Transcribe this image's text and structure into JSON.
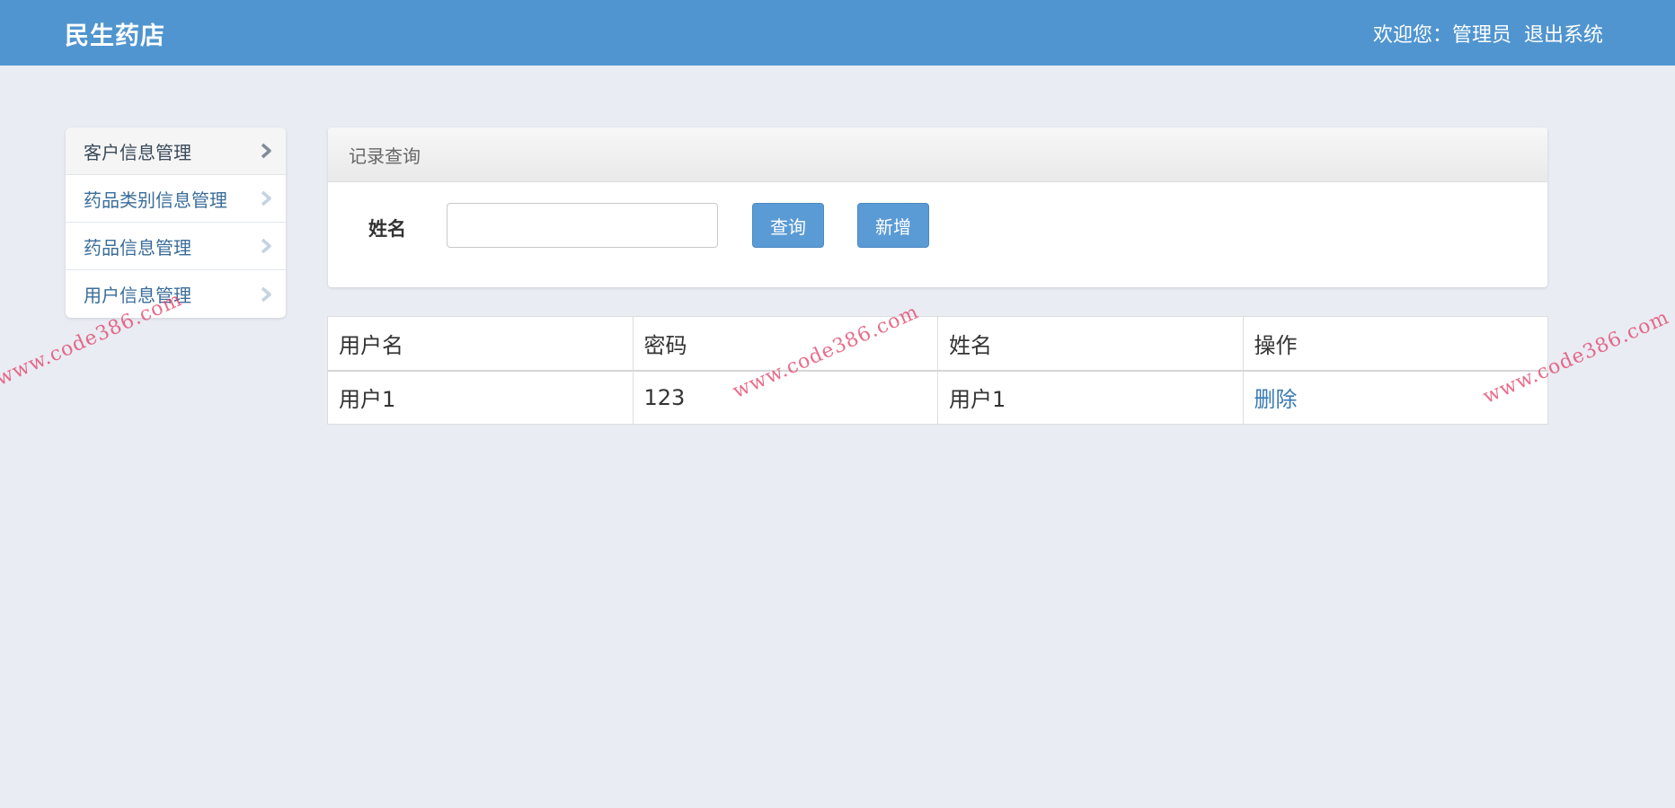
{
  "header": {
    "brand": "民生药店",
    "welcome": "欢迎您：管理员",
    "logout": "退出系统"
  },
  "sidebar": {
    "items": [
      {
        "label": "客户信息管理"
      },
      {
        "label": "药品类别信息管理"
      },
      {
        "label": "药品信息管理"
      },
      {
        "label": "用户信息管理"
      }
    ]
  },
  "panel": {
    "title": "记录查询",
    "name_label": "姓名",
    "name_value": "",
    "search_label": "查询",
    "add_label": "新增"
  },
  "table": {
    "columns": [
      "用户名",
      "密码",
      "姓名",
      "操作"
    ],
    "rows": [
      {
        "username": "用户1",
        "password": "123",
        "name": "用户1",
        "action": "删除"
      }
    ]
  },
  "watermark": "www.code386.com",
  "colors": {
    "header_bg": "#5095d0",
    "page_bg": "#e9ecf3",
    "button_bg": "#5b9bd5",
    "link": "#3a7ab3",
    "watermark": "#e13c64"
  },
  "icons": {
    "sidebar_chevron": "chevron-right-icon"
  }
}
